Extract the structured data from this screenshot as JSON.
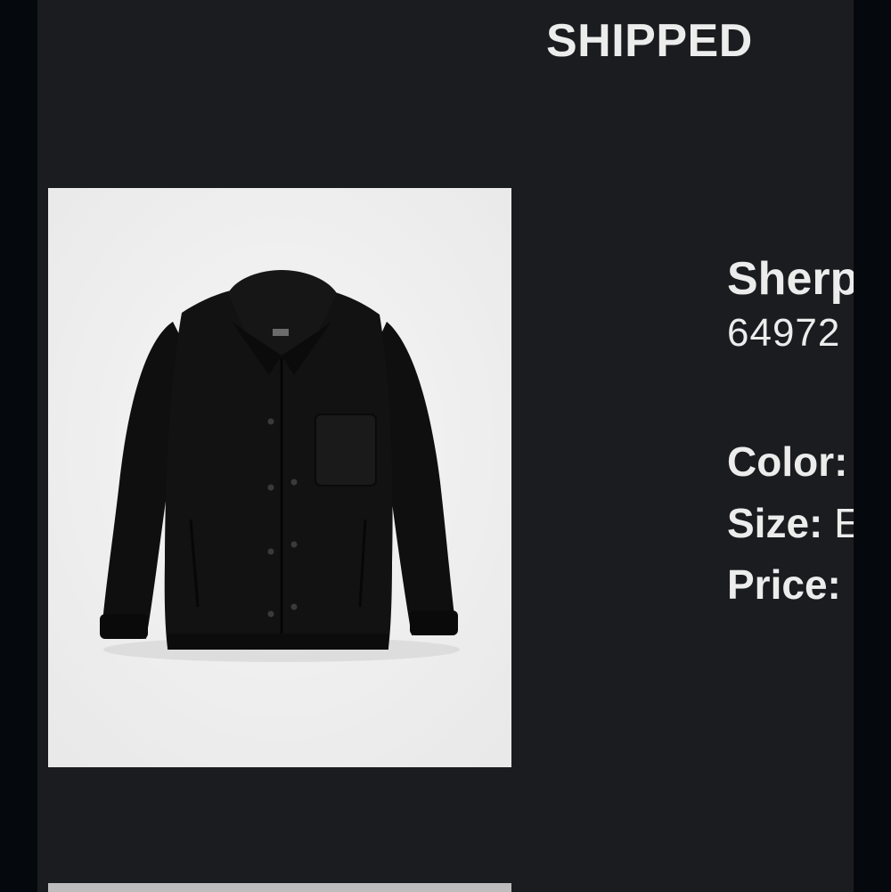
{
  "order": {
    "status": "SHIPPED"
  },
  "item": {
    "image_alt": "Black sherpa jacket",
    "name": "Sherp",
    "sku": "64972",
    "color_label": "Color:",
    "color_value": "",
    "size_label": "Size:",
    "size_value": "E",
    "price_label": "Price:",
    "price_value": ""
  },
  "colors": {
    "page_bg": "#05090d",
    "panel_bg": "#1b1c1f",
    "text": "#ececec",
    "photo_bg": "#efefef",
    "jacket": "#101010"
  }
}
